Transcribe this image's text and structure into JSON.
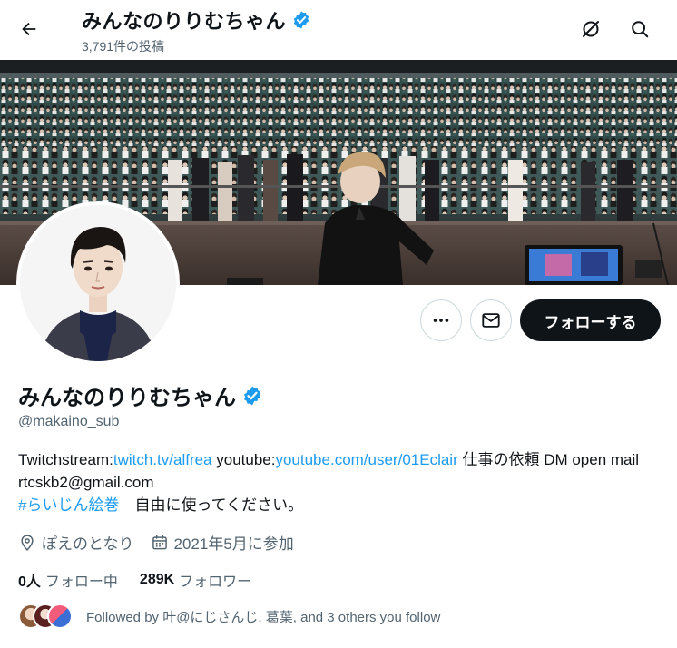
{
  "header": {
    "title": "みんなのりりむちゃん",
    "post_count": "3,791件の投稿"
  },
  "profile": {
    "name": "みんなのりりむちゃん",
    "handle": "@makaino_sub",
    "bio": {
      "prefix": "Twitchstream:",
      "link1": "twitch.tv/alfrea",
      "mid": " youtube:",
      "link2": "youtube.com/user/01Eclair",
      "suffix": " 仕事の依頼 DM open mail rtcskb2@gmail.com",
      "hashtag": "#らいじん絵巻",
      "tail": "　自由に使ってください。"
    },
    "location": "ぽえのとなり",
    "joined": "2021年5月に参加",
    "following_count": "0人",
    "following_label": "フォロー中",
    "followers_count": "289K",
    "followers_label": "フォロワー",
    "followed_by": "Followed by 叶@にじさんじ, 葛葉, and 3 others you follow"
  },
  "actions": {
    "follow_label": "フォローする"
  },
  "colors": {
    "accent": "#1d9bf0",
    "verified": "#1d9bf0",
    "follow_button": "#0f1419",
    "muted_text": "#536471"
  },
  "icons": {
    "back": "arrow-left-icon",
    "rss": "notifications-off-icon",
    "search": "search-icon",
    "more": "more-icon",
    "message": "mail-icon",
    "location": "location-pin-icon",
    "calendar": "calendar-icon",
    "verified": "verified-badge-icon"
  }
}
